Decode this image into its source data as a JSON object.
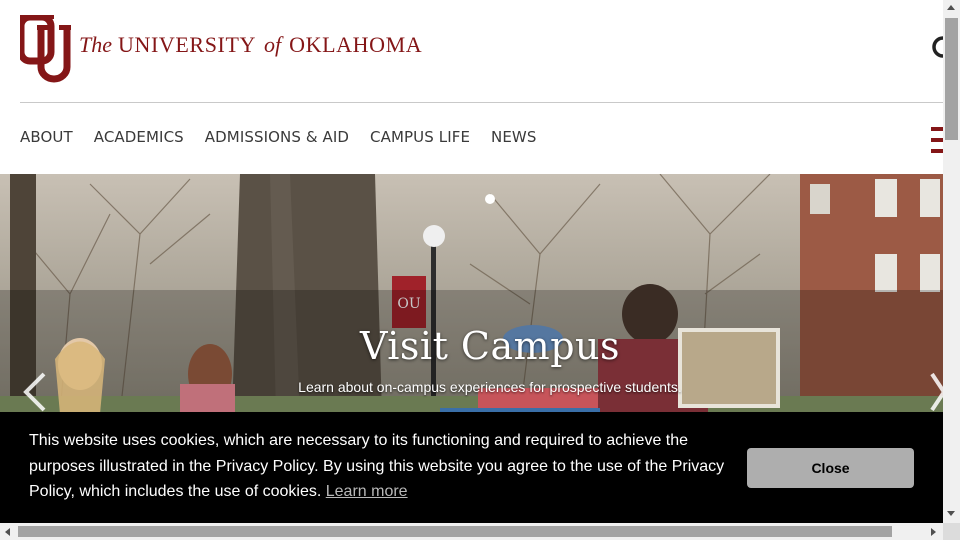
{
  "header": {
    "logo_text": "OU",
    "wordmark": {
      "the": "The",
      "university": "UNIVERSITY",
      "of": "of",
      "name": "OKLAHOMA"
    },
    "search_icon": "search-icon"
  },
  "nav": {
    "items": [
      {
        "label": "ABOUT"
      },
      {
        "label": "ACADEMICS"
      },
      {
        "label": "ADMISSIONS & AID"
      },
      {
        "label": "CAMPUS LIFE"
      },
      {
        "label": "NEWS"
      }
    ],
    "menu_icon": "hamburger-menu-icon"
  },
  "hero": {
    "title": "Visit Campus",
    "subtitle": "Learn about on-campus experiences for prospective students.",
    "banner_logo": "OU",
    "prev_icon": "chevron-left-icon",
    "next_icon": "chevron-right-icon"
  },
  "cookie": {
    "text": "This website uses cookies, which are necessary to its functioning and required to achieve the purposes illustrated in the Privacy Policy. By using this website you agree to the use of the Privacy Policy, which includes the use of cookies.",
    "link": "Learn more",
    "close": "Close"
  },
  "colors": {
    "brand_crimson": "#841617",
    "banner_bg": "#000000",
    "close_button": "#aeaeae"
  }
}
